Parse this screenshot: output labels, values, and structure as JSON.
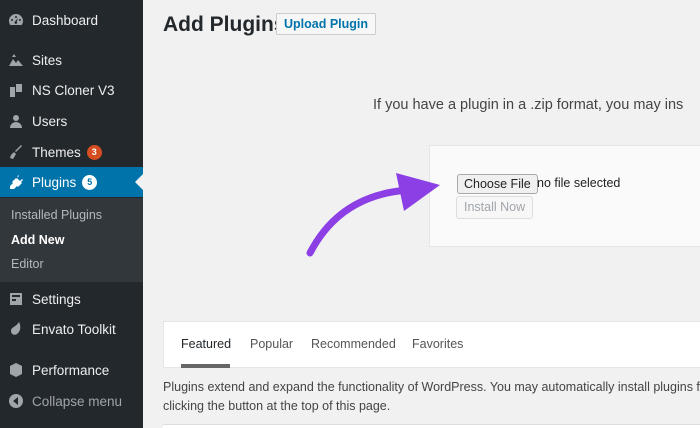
{
  "sidebar": {
    "items": [
      {
        "label": "Dashboard",
        "icon": "dashboard-icon"
      },
      {
        "label": "Sites",
        "icon": "sites-icon"
      },
      {
        "label": "NS Cloner V3",
        "icon": "cloner-icon"
      },
      {
        "label": "Users",
        "icon": "users-icon"
      },
      {
        "label": "Themes",
        "icon": "themes-icon",
        "badge": "3"
      },
      {
        "label": "Plugins",
        "icon": "plugins-icon",
        "badge": "5"
      },
      {
        "label": "Settings",
        "icon": "settings-icon"
      },
      {
        "label": "Envato Toolkit",
        "icon": "envato-icon"
      },
      {
        "label": "Performance",
        "icon": "performance-icon"
      },
      {
        "label": "Collapse menu",
        "icon": "collapse-icon"
      }
    ],
    "submenu": [
      {
        "label": "Installed Plugins"
      },
      {
        "label": "Add New"
      },
      {
        "label": "Editor"
      }
    ]
  },
  "main": {
    "title": "Add Plugins",
    "upload_button": "Upload Plugin",
    "intro": "If you have a plugin in a .zip format, you may ins",
    "choose_file": "Choose File",
    "no_file": "no file selected",
    "install_now": "Install Now"
  },
  "tabs": [
    {
      "label": "Featured"
    },
    {
      "label": "Popular"
    },
    {
      "label": "Recommended"
    },
    {
      "label": "Favorites"
    }
  ],
  "description": {
    "line1": "Plugins extend and expand the functionality of WordPress. You may automatically install plugins from",
    "line2": "clicking the button at the top of this page."
  },
  "colors": {
    "sidebar_bg": "#23282d",
    "active_bg": "#0073aa",
    "arrow": "#8b3fe4",
    "badge_red": "#d54e21"
  }
}
